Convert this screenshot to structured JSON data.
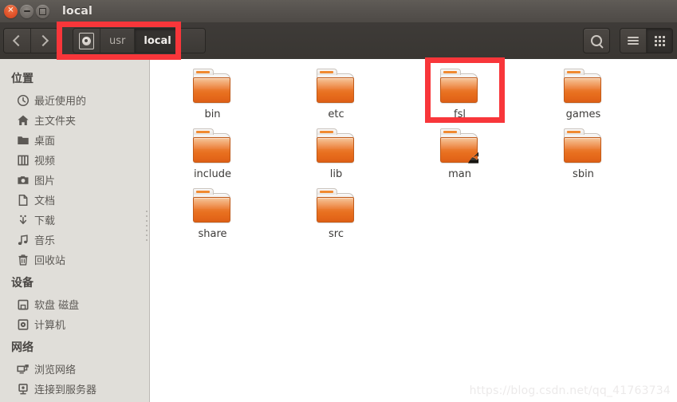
{
  "window": {
    "title": "local",
    "controls": {
      "close": "close-button",
      "minimize": "minimize-button",
      "maximize": "maximize-button"
    }
  },
  "toolbar": {
    "back_label": "‹",
    "forward_label": "›",
    "breadcrumb": [
      {
        "label": "",
        "icon": "filesystem-icon",
        "active": false
      },
      {
        "label": "usr",
        "active": false
      },
      {
        "label": "local",
        "active": true
      }
    ],
    "search_icon": "search-icon",
    "list_view_icon": "list-view-icon",
    "grid_view_icon": "grid-view-icon"
  },
  "sidebar": {
    "sections": [
      {
        "heading": "位置",
        "items": [
          {
            "label": "最近使用的",
            "icon": "clock-icon"
          },
          {
            "label": "主文件夹",
            "icon": "home-icon"
          },
          {
            "label": "桌面",
            "icon": "folder-icon"
          },
          {
            "label": "视频",
            "icon": "video-icon"
          },
          {
            "label": "图片",
            "icon": "camera-icon"
          },
          {
            "label": "文档",
            "icon": "document-icon"
          },
          {
            "label": "下载",
            "icon": "download-icon"
          },
          {
            "label": "音乐",
            "icon": "music-icon"
          },
          {
            "label": "回收站",
            "icon": "trash-icon"
          }
        ]
      },
      {
        "heading": "设备",
        "items": [
          {
            "label": "软盘 磁盘",
            "icon": "floppy-disk-icon"
          },
          {
            "label": "计算机",
            "icon": "computer-icon"
          }
        ]
      },
      {
        "heading": "网络",
        "items": [
          {
            "label": "浏览网络",
            "icon": "network-browse-icon"
          },
          {
            "label": "连接到服务器",
            "icon": "server-connect-icon"
          }
        ]
      }
    ]
  },
  "files": {
    "rows": [
      [
        {
          "name": "bin",
          "type": "folder",
          "symlink": false
        },
        {
          "name": "etc",
          "type": "folder",
          "symlink": false
        },
        {
          "name": "fsl",
          "type": "folder",
          "symlink": false,
          "highlighted": true
        },
        {
          "name": "games",
          "type": "folder",
          "symlink": false
        }
      ],
      [
        {
          "name": "include",
          "type": "folder",
          "symlink": false
        },
        {
          "name": "lib",
          "type": "folder",
          "symlink": false
        },
        {
          "name": "man",
          "type": "folder",
          "symlink": true
        },
        {
          "name": "sbin",
          "type": "folder",
          "symlink": false
        }
      ],
      [
        {
          "name": "share",
          "type": "folder",
          "symlink": false
        },
        {
          "name": "src",
          "type": "folder",
          "symlink": false
        }
      ]
    ]
  },
  "annotations": [
    {
      "name": "breadcrumb-highlight",
      "color": "#f8363a"
    },
    {
      "name": "fsl-folder-highlight",
      "color": "#f8363a"
    }
  ],
  "watermark": "https://blog.csdn.net/qq_41763734"
}
